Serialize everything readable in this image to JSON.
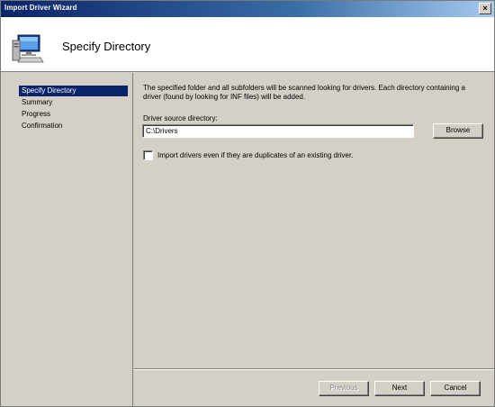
{
  "window": {
    "title": "Import Driver Wizard",
    "close_glyph": "×"
  },
  "header": {
    "title": "Specify Directory",
    "icon": "computer-icon"
  },
  "nav": {
    "items": [
      {
        "label": "Specify Directory",
        "active": true
      },
      {
        "label": "Summary",
        "active": false
      },
      {
        "label": "Progress",
        "active": false
      },
      {
        "label": "Confirmation",
        "active": false
      }
    ]
  },
  "content": {
    "description": "The specified folder and all subfolders will be scanned looking for drivers.  Each directory containing a driver (found by looking for INF files) will be added.",
    "source_label": "Driver source directory:",
    "source_value": "C:\\Drivers",
    "browse_label": "Browse",
    "checkbox_label": "Import drivers even if they are duplicates of an existing driver.",
    "checkbox_checked": false
  },
  "footer": {
    "previous_label": "Previous",
    "next_label": "Next",
    "cancel_label": "Cancel"
  },
  "colors": {
    "title_start": "#0a246a",
    "title_end": "#a6caf0",
    "face": "#d4d0c8",
    "selection": "#0a246a"
  }
}
